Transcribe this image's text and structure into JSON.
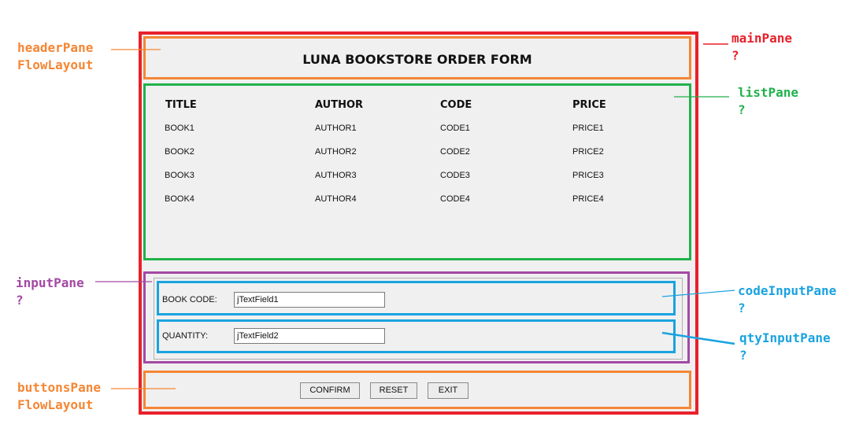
{
  "colors": {
    "red": "#e8212b",
    "orange": "#f58634",
    "green": "#22b14c",
    "purple": "#a349a4",
    "blue": "#1aa3e0"
  },
  "annotations": {
    "headerPane": {
      "name": "headerPane",
      "layout": "FlowLayout"
    },
    "mainPane": {
      "name": "mainPane",
      "mark": "?"
    },
    "listPane": {
      "name": "listPane",
      "mark": "?"
    },
    "inputPane": {
      "name": "inputPane",
      "mark": "?"
    },
    "codeInputPane": {
      "name": "codeInputPane",
      "mark": "?"
    },
    "qtyInputPane": {
      "name": "qtyInputPane",
      "mark": "?"
    },
    "buttonsPane": {
      "name": "buttonsPane",
      "layout": "FlowLayout"
    }
  },
  "form": {
    "title": "LUNA BOOKSTORE ORDER FORM",
    "columns": [
      "TITLE",
      "AUTHOR",
      "CODE",
      "PRICE"
    ],
    "rows": [
      [
        "BOOK1",
        "AUTHOR1",
        "CODE1",
        "PRICE1"
      ],
      [
        "BOOK2",
        "AUTHOR2",
        "CODE2",
        "PRICE2"
      ],
      [
        "BOOK3",
        "AUTHOR3",
        "CODE3",
        "PRICE3"
      ],
      [
        "BOOK4",
        "AUTHOR4",
        "CODE4",
        "PRICE4"
      ]
    ],
    "code_label": "BOOK CODE:",
    "code_value": "jTextField1",
    "qty_label": "QUANTITY:",
    "qty_value": "jTextField2",
    "buttons": [
      "CONFIRM",
      "RESET",
      "EXIT"
    ]
  }
}
